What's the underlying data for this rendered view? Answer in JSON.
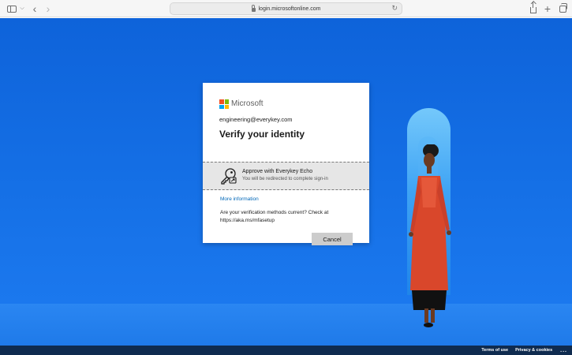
{
  "browser": {
    "url": "login.microsoftonline.com"
  },
  "card": {
    "brand": "Microsoft",
    "email": "engineering@everykey.com",
    "heading": "Verify your identity",
    "option": {
      "title": "Approve with Everykey Echo",
      "subtitle": "You will be redirected to complete sign-in"
    },
    "more_info": "More information",
    "note": "Are your verification methods current? Check at https://aka.ms/mfasetup",
    "cancel_label": "Cancel"
  },
  "footer": {
    "terms": "Terms of use",
    "privacy": "Privacy & cookies",
    "more": "..."
  },
  "colors": {
    "background": "#1a73e8",
    "link": "#0067b8",
    "footer": "#0f2b4f"
  }
}
